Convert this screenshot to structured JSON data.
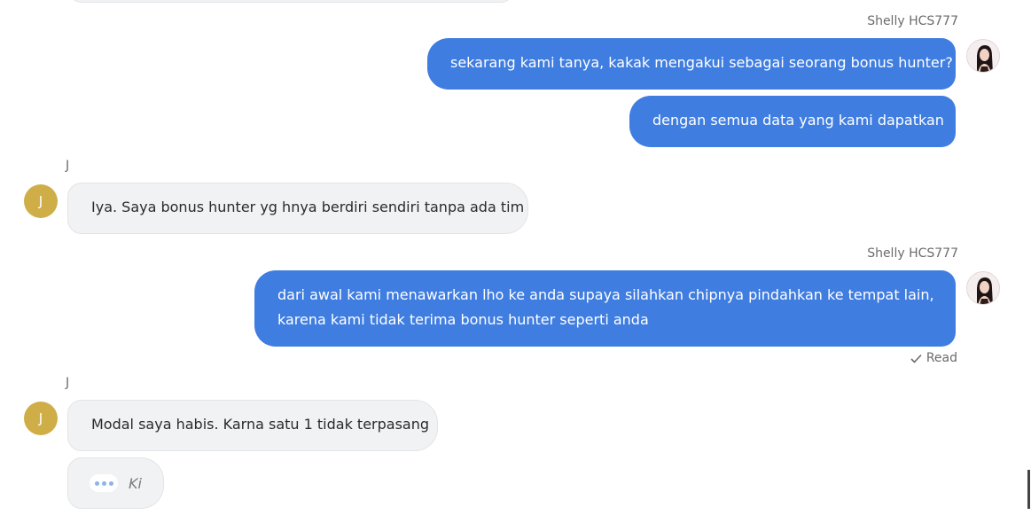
{
  "messages": [
    {
      "side": "agent",
      "sender": "Shelly HCS777",
      "lines": [
        "sekarang kami tanya, kakak mengakui sebagai seorang bonus hunter?"
      ]
    },
    {
      "side": "agent",
      "lines": [
        "dengan semua data yang kami dapatkan"
      ]
    },
    {
      "side": "customer",
      "sender": "J",
      "avatar_initial": "J",
      "lines": [
        "Iya. Saya bonus hunter yg hnya berdiri sendiri tanpa ada tim"
      ]
    },
    {
      "side": "agent",
      "sender": "Shelly HCS777",
      "lines": [
        "dari awal kami menawarkan lho ke anda supaya silahkan chipnya pindahkan ke tempat lain,",
        "karena kami tidak terima bonus hunter seperti anda"
      ],
      "status": "Read"
    },
    {
      "side": "customer",
      "sender": "J",
      "avatar_initial": "J",
      "lines": [
        "Modal saya habis. Karna satu 1 tidak terpasang"
      ]
    }
  ],
  "typing": {
    "text": "Ki"
  },
  "icons": {
    "read": "checkmark-icon",
    "typing": "typing-dots-icon",
    "agent_avatar": "agent-photo-avatar"
  },
  "colors": {
    "agent_bubble": "#3f7de0",
    "customer_bubble": "#f1f2f4",
    "customer_avatar": "#cfae48"
  }
}
